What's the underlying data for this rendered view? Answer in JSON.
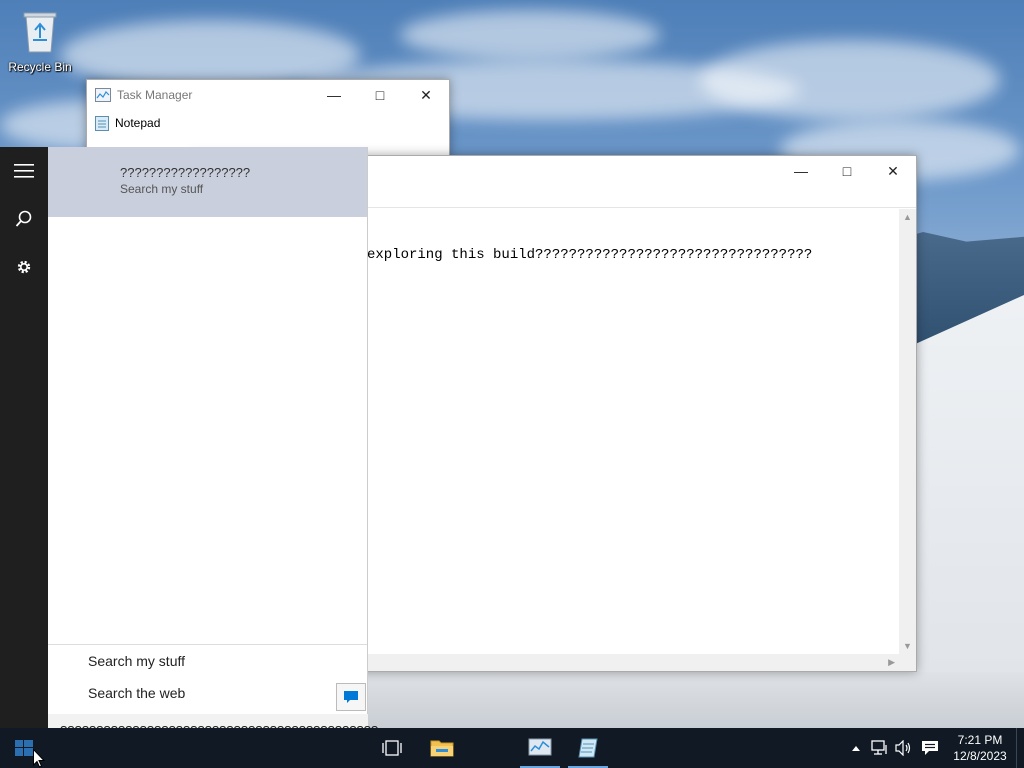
{
  "desktop": {
    "recycle_bin_label": "Recycle Bin"
  },
  "task_manager": {
    "title": "Task Manager",
    "process": "Notepad"
  },
  "notepad": {
    "content": "exploring this build?????????????????????????????????"
  },
  "search_panel": {
    "result_title": "??????????????????",
    "result_sub": "Search my stuff",
    "option_my_stuff": "Search my stuff",
    "option_web": "Search the web",
    "query_text": "????????????????????????????????????????????\n??????"
  },
  "taskbar": {
    "time": "7:21 PM",
    "date": "12/8/2023"
  },
  "colors": {
    "taskbar_bg": "#111a24",
    "leftbar_bg": "#1f1f1f",
    "result_highlight": "#c9cfdc",
    "accent": "#0078d7"
  }
}
